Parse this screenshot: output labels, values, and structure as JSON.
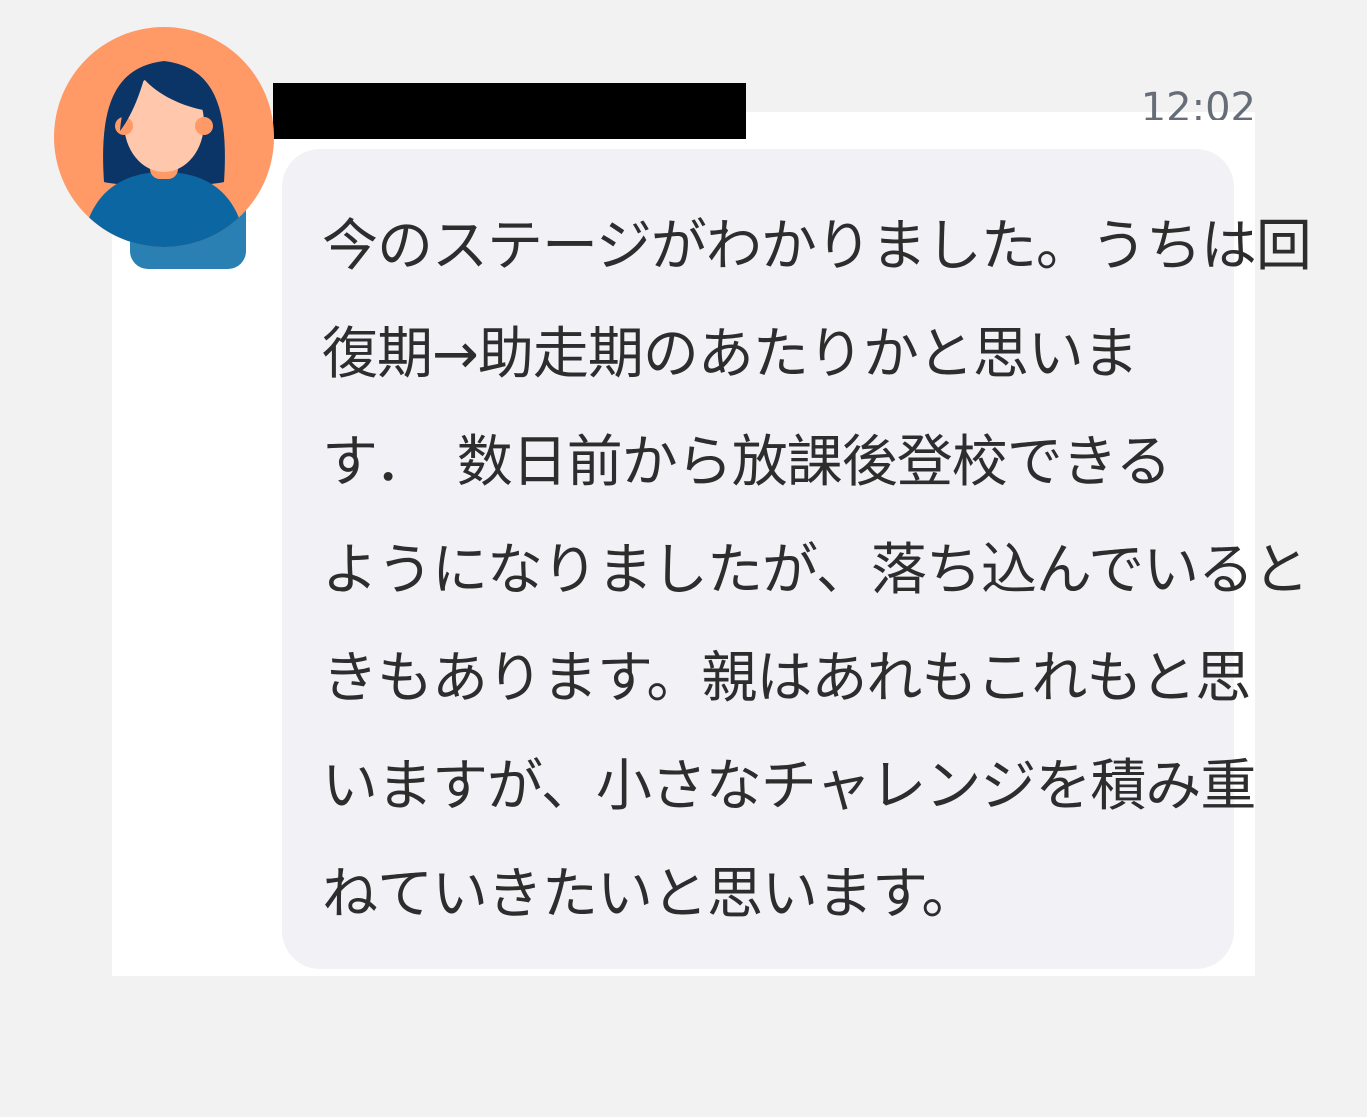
{
  "message": {
    "timestamp": "12:02",
    "lines": [
      "今のステージがわかりました。うちは回",
      "復期→助走期のあたりかと思いま",
      "す．　数日前から放課後登校できる",
      "ようになりましたが、落ち込んでいると",
      "きもあります。親はあれもこれもと思",
      "いますが、小さなチャレンジを積み重",
      "ねていきたいと思います。"
    ]
  },
  "colors": {
    "page_background": "#f2f2f2",
    "card_background": "#ffffff",
    "bubble_background": "#f2f2f6",
    "avatar_background": "#ff9966",
    "avatar_hair": "#0b3566",
    "avatar_shirt": "#0b66a1",
    "text": "#2d2d2d"
  },
  "icons": {
    "avatar": "woman-avatar-icon"
  }
}
